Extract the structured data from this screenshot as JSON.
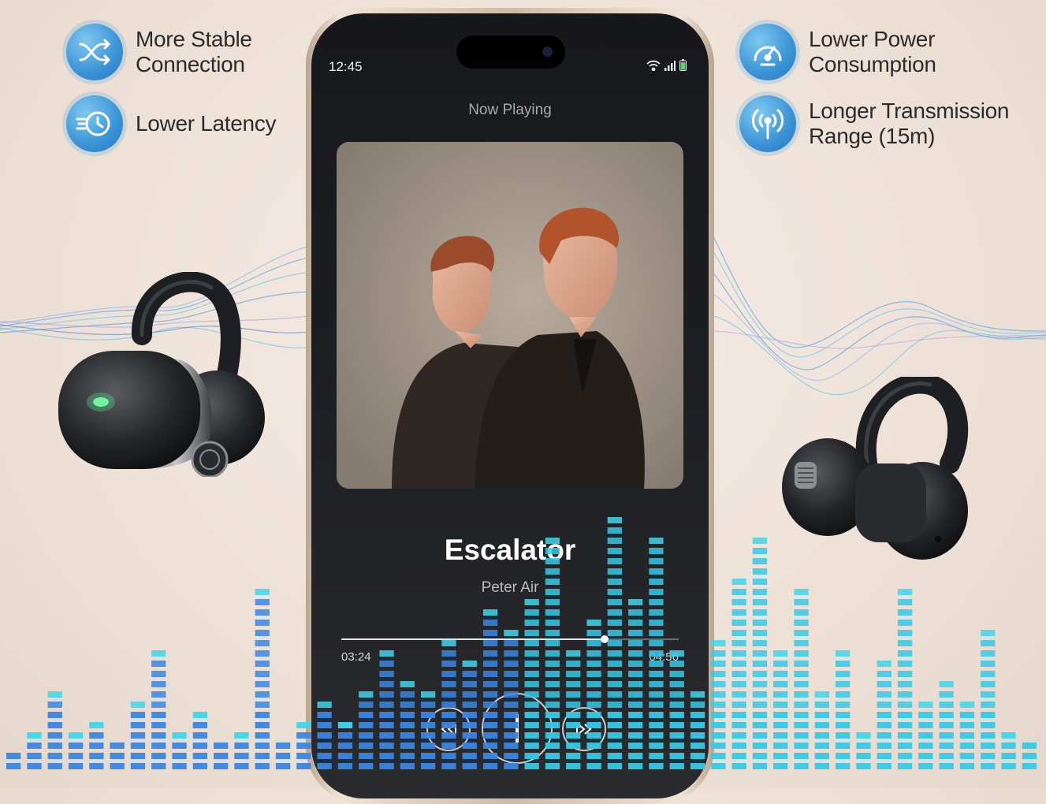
{
  "features": [
    {
      "label": "More Stable\nConnection",
      "icon": "shuffle-arrows-icon"
    },
    {
      "label": "Lower Latency",
      "icon": "fast-clock-icon"
    },
    {
      "label": "Lower Power\nConsumption",
      "icon": "speedometer-icon"
    },
    {
      "label": "Longer Transmission\nRange (15m)",
      "icon": "broadcast-signal-icon"
    }
  ],
  "phone": {
    "clock": "12:45",
    "header": "Now Playing",
    "song_title": "Escalator",
    "artist": "Peter Air",
    "current_time": "03:24",
    "total_time": "04:56",
    "progress": 0.78
  },
  "colors": {
    "icon_blue": "#3a93d6",
    "eq_cyan": "#39d2e8",
    "eq_blue": "#3a7ee0",
    "background": "#efe3d8"
  }
}
